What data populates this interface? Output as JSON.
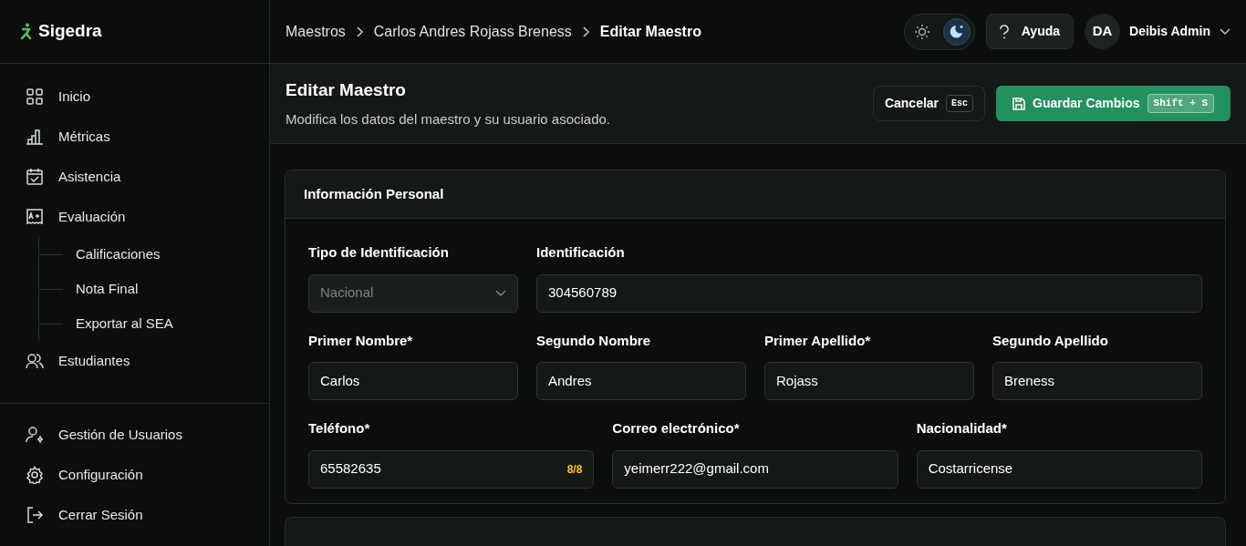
{
  "brand": "Sigedra",
  "sidebar": {
    "items": [
      {
        "label": "Inicio"
      },
      {
        "label": "Métricas"
      },
      {
        "label": "Asistencia"
      },
      {
        "label": "Evaluación",
        "children": [
          {
            "label": "Calificaciones"
          },
          {
            "label": "Nota Final"
          },
          {
            "label": "Exportar al SEA"
          }
        ]
      },
      {
        "label": "Estudiantes"
      }
    ],
    "footer_items": [
      {
        "label": "Gestión de Usuarios"
      },
      {
        "label": "Configuración"
      },
      {
        "label": "Cerrar Sesión"
      }
    ]
  },
  "breadcrumb": [
    {
      "label": "Maestros",
      "current": false
    },
    {
      "label": "Carlos Andres Rojass Breness",
      "current": false
    },
    {
      "label": "Editar Maestro",
      "current": true
    }
  ],
  "theme_toggle": [
    {
      "selected": false
    },
    {
      "selected": true
    }
  ],
  "help_button": "Ayuda",
  "user": {
    "initials": "DA",
    "name": "Deibis Admin"
  },
  "page": {
    "title": "Editar Maestro",
    "subtitle": "Modifica los datos del maestro y su usuario asociado.",
    "cancel": {
      "label": "Cancelar",
      "shortcut": "Esc"
    },
    "save": {
      "label": "Guardar Cambios",
      "shortcut": "Shift + S"
    }
  },
  "section": {
    "title": "Información Personal",
    "rows": [
      [
        {
          "label": "Tipo de Identificación",
          "kind": "select",
          "value": "Nacional",
          "disabled": true
        },
        {
          "label": "Identificación",
          "kind": "text",
          "value": "304560789",
          "disabled": false
        }
      ],
      [
        {
          "label": "Primer Nombre*",
          "kind": "text",
          "value": "Carlos",
          "disabled": false
        },
        {
          "label": "Segundo Nombre",
          "kind": "text",
          "value": "Andres",
          "disabled": false
        },
        {
          "label": "Primer Apellido*",
          "kind": "text",
          "value": "Rojass",
          "disabled": false
        },
        {
          "label": "Segundo Apellido",
          "kind": "text",
          "value": "Breness",
          "disabled": false
        }
      ],
      [
        {
          "label": "Teléfono*",
          "kind": "text",
          "value": "65582635",
          "counter": "8/8",
          "disabled": false
        },
        {
          "label": "Correo electrónico*",
          "kind": "text",
          "value": "yeimerr222@gmail.com",
          "disabled": false
        },
        {
          "label": "Nacionalidad*",
          "kind": "text",
          "value": "Costarricense",
          "disabled": false
        }
      ]
    ]
  }
}
